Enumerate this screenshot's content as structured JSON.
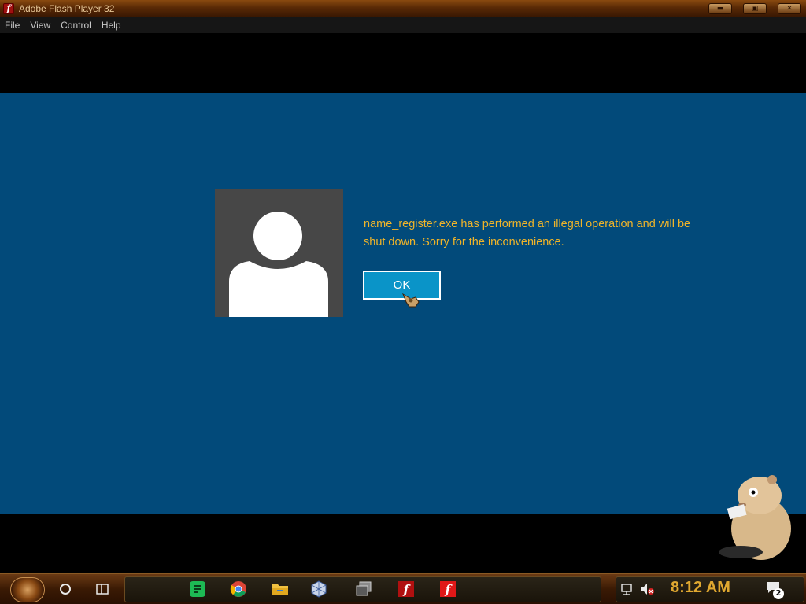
{
  "window": {
    "title": "Adobe Flash Player 32",
    "icon": "flash-icon"
  },
  "menu": {
    "items": [
      "File",
      "View",
      "Control",
      "Help"
    ]
  },
  "dialog": {
    "message": "name_register.exe has performed an illegal operation and will be shut down. Sorry for the inconvenience.",
    "ok_label": "OK",
    "text_color": "#f0b429",
    "background_color": "#024a7a",
    "button_color": "#0a94c8"
  },
  "taskbar": {
    "clock": "8:12 AM",
    "notification_count": "2",
    "icons": [
      "start-icon",
      "cortana-icon",
      "task-view-icon",
      "notes-icon",
      "chrome-icon",
      "file-explorer-icon",
      "virtualbox-icon",
      "multi-window-icon",
      "flash-icon",
      "flash-icon"
    ]
  }
}
